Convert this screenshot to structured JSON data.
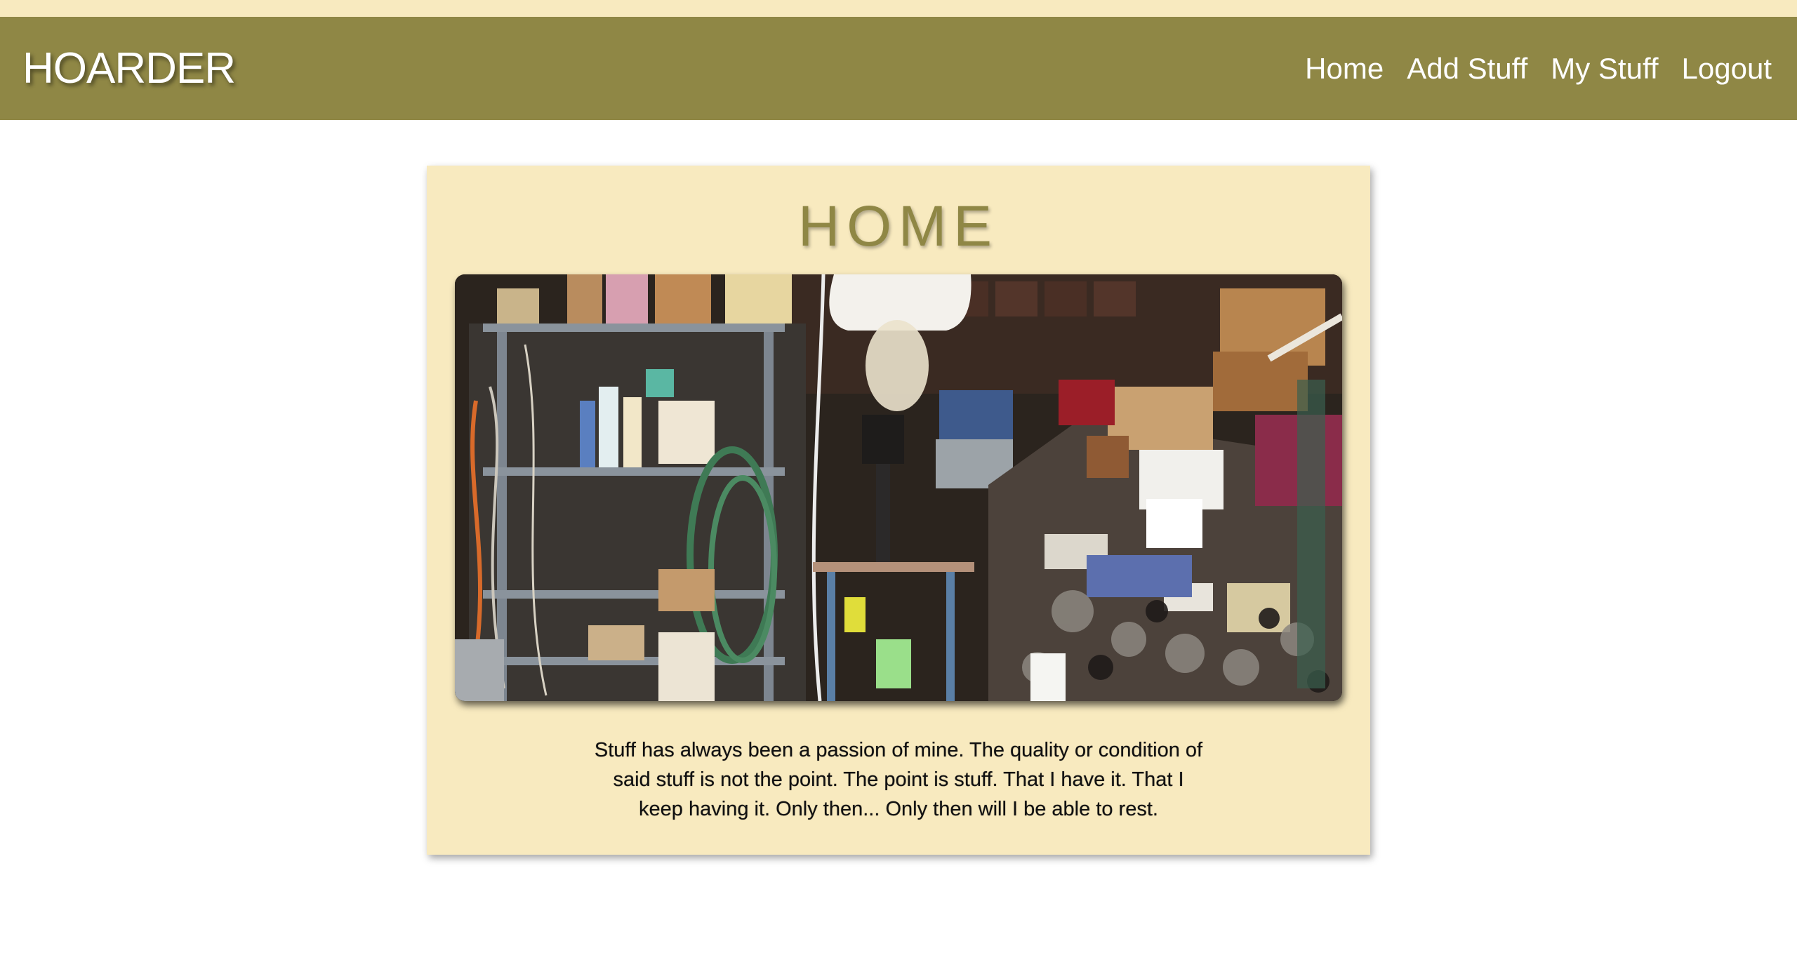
{
  "brand": "HOARDER",
  "nav": {
    "items": [
      {
        "label": "Home"
      },
      {
        "label": "Add Stuff"
      },
      {
        "label": "My Stuff"
      },
      {
        "label": "Logout"
      }
    ]
  },
  "main": {
    "title": "HOME",
    "caption": "Stuff has always been a passion of mine. The quality or condition of said stuff is not the point. The point is stuff. That I have it. That I keep having it. Only then... Only then will I be able to rest."
  },
  "colors": {
    "navbar": "#8f8745",
    "card": "#f8eabf",
    "top_strip": "#f8eabf",
    "title": "#8f8745"
  }
}
